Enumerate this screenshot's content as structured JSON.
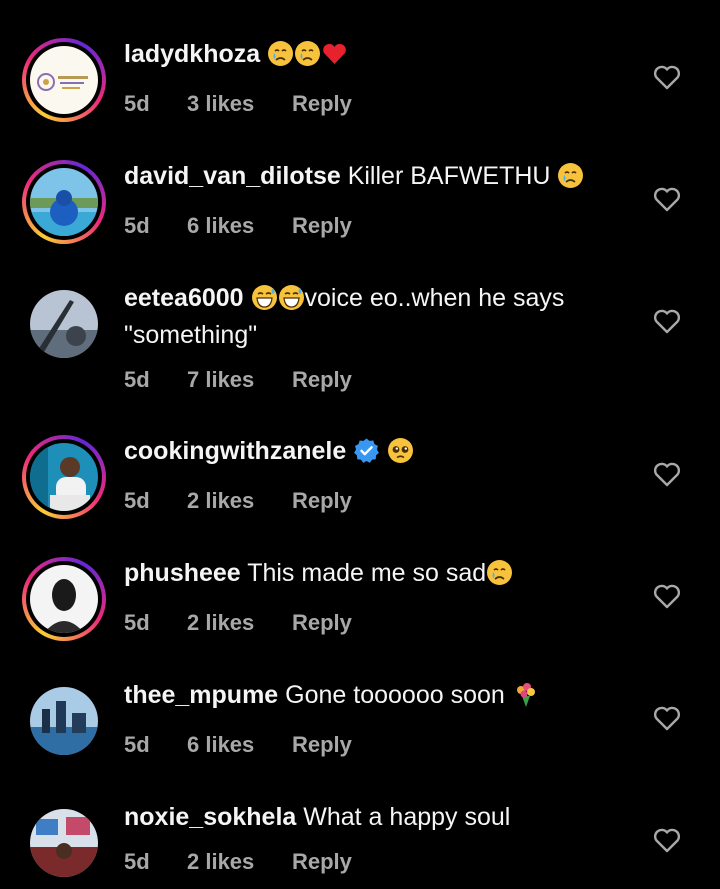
{
  "comments": [
    {
      "username": "ladydkhoza",
      "text": "",
      "emojis": [
        "crying-face",
        "crying-face",
        "red-heart"
      ],
      "time": "5d",
      "likes": "3 likes",
      "reply": "Reply",
      "avatar_ring": true,
      "verified": false
    },
    {
      "username": "david_van_dilotse",
      "text": "Killer BAFWETHU",
      "emojis": [
        "crying-face"
      ],
      "time": "5d",
      "likes": "6 likes",
      "reply": "Reply",
      "avatar_ring": true,
      "verified": false
    },
    {
      "username": "eetea6000",
      "text_before": "",
      "emojis": [
        "grinning-sweat-face",
        "grinning-sweat-face"
      ],
      "text": "voice eo..when he says \"something\"",
      "time": "5d",
      "likes": "7 likes",
      "reply": "Reply",
      "avatar_ring": false,
      "verified": false
    },
    {
      "username": "cookingwithzanele",
      "text": "",
      "emojis": [
        "pleading-face"
      ],
      "time": "5d",
      "likes": "2 likes",
      "reply": "Reply",
      "avatar_ring": true,
      "verified": true
    },
    {
      "username": "phusheee",
      "text": "This made me so sad",
      "emojis": [
        "crying-face"
      ],
      "time": "5d",
      "likes": "2 likes",
      "reply": "Reply",
      "avatar_ring": true,
      "verified": false
    },
    {
      "username": "thee_mpume",
      "text": "Gone toooooo soon",
      "emojis": [
        "bouquet"
      ],
      "time": "5d",
      "likes": "6 likes",
      "reply": "Reply",
      "avatar_ring": false,
      "verified": false
    },
    {
      "username": "noxie_sokhela",
      "text": "What a happy soul",
      "emojis": [],
      "time": "5d",
      "likes": "2 likes",
      "reply": "Reply",
      "avatar_ring": false,
      "verified": false
    }
  ],
  "colors": {
    "background": "#000000",
    "text": "#f5f5f5",
    "meta": "#a8a8a8",
    "verified": "#3897f0"
  }
}
